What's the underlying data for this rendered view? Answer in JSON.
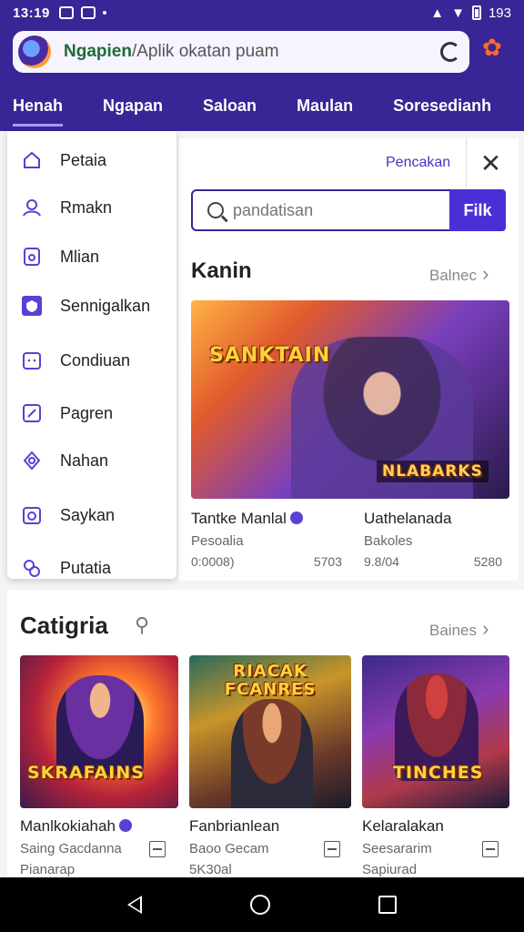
{
  "status_bar": {
    "time": "13:19",
    "battery": "193",
    "icons": [
      "notification-icon",
      "notification-icon",
      "signal-icon",
      "wifi-icon",
      "battery-icon"
    ]
  },
  "url_bar": {
    "host": "Ngapien",
    "path": "/Aplik okatan puam"
  },
  "top_nav": {
    "tabs": [
      "Henah",
      "Ngapan",
      "Saloan",
      "Maulan",
      "Soresedianh"
    ],
    "active_index": 0
  },
  "drawer": {
    "items": [
      {
        "label": "Petaia",
        "icon": "home-icon"
      },
      {
        "label": "Rmakn",
        "icon": "users-icon"
      },
      {
        "label": "Mlian",
        "icon": "tablet-icon"
      },
      {
        "label": "Sennigalkan",
        "icon": "shield-icon"
      },
      {
        "label": "Condiuan",
        "icon": "calendar-icon"
      },
      {
        "label": "Pagren",
        "icon": "edit-icon"
      },
      {
        "label": "Nahan",
        "icon": "puzzle-icon"
      },
      {
        "label": "Saykan",
        "icon": "camera-icon"
      },
      {
        "label": "Putatia",
        "icon": "group-icon"
      }
    ]
  },
  "panel": {
    "filter_link": "Pencakan",
    "search": {
      "placeholder": "pandatisan",
      "button": "Filk"
    },
    "section1": {
      "title": "Kanin",
      "see_all": "Balnec"
    },
    "section2": {
      "title": "Catigria",
      "see_all": "Baines"
    }
  },
  "cards_featured": [
    {
      "name": "Tantke Manlal",
      "sub": "Pesoalia",
      "meta_left": "0:0008)",
      "meta_right": "5703",
      "logo": "SANKTAIN",
      "logo2": "NLABARKS",
      "verified": true
    },
    {
      "name": "Uathelanada",
      "sub": "Bakoles",
      "meta_left": "9.8/04",
      "meta_right": "5280",
      "verified": false
    }
  ],
  "cards_category": [
    {
      "name": "Manlkokiahah",
      "sub": "Saing Gacdanna",
      "meta": "Pianarap",
      "logo": "SKRAFAINS",
      "verified": true
    },
    {
      "name": "Fanbrianlean",
      "sub": "Baoo Gecam",
      "meta": "5K30al",
      "logo": "RIACAK FCANRES",
      "verified": false
    },
    {
      "name": "Kelaralakan",
      "sub": "Seesararim",
      "meta": "Sapiurad",
      "logo": "TINCHES",
      "verified": false
    }
  ],
  "colors": {
    "brand": "#3a2596",
    "accent": "#4b2fd6"
  }
}
